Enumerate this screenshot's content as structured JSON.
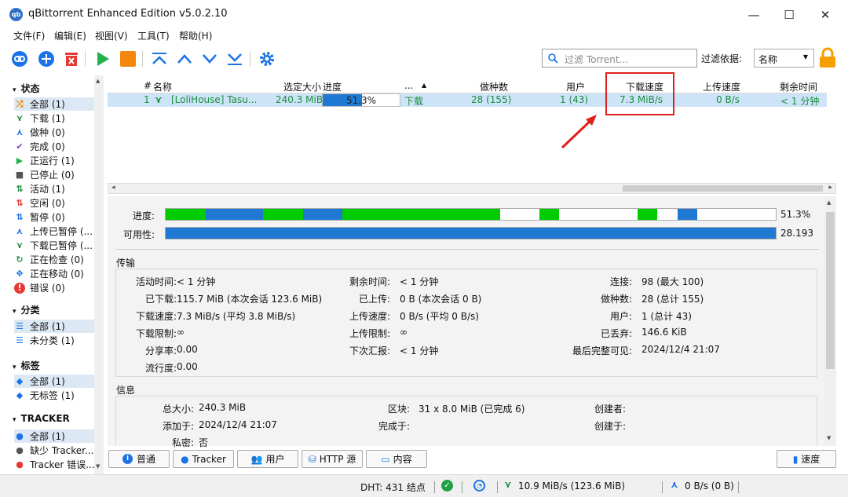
{
  "window": {
    "title": "qBittorrent Enhanced Edition v5.0.2.10",
    "icon_text": "qb",
    "min": "—",
    "max": "☐",
    "close": "✕"
  },
  "menu": [
    "文件(F)",
    "编辑(E)",
    "视图(V)",
    "工具(T)",
    "帮助(H)"
  ],
  "toolbar": {
    "filter_placeholder": "过滤 Torrent...",
    "filter_by_label": "过滤依据:",
    "filter_by_value": "名称"
  },
  "sidebar": {
    "status_header": "状态",
    "status_items": [
      {
        "label": "全部 (1)",
        "icon": "shuffle-icon"
      },
      {
        "label": "下载 (1)",
        "icon": "download-chevrons-icon"
      },
      {
        "label": "做种 (0)",
        "icon": "upload-chevrons-icon"
      },
      {
        "label": "完成 (0)",
        "icon": "check-icon"
      },
      {
        "label": "正运行 (1)",
        "icon": "play-icon"
      },
      {
        "label": "已停止 (0)",
        "icon": "stop-icon"
      },
      {
        "label": "活动 (1)",
        "icon": "active-arrows-icon"
      },
      {
        "label": "空闲 (0)",
        "icon": "idle-arrows-icon"
      },
      {
        "label": "暂停 (0)",
        "icon": "paused-arrows-icon"
      },
      {
        "label": "上传已暂停 (...",
        "icon": "upload-paused-icon"
      },
      {
        "label": "下载已暂停 (...",
        "icon": "download-paused-icon"
      },
      {
        "label": "正在检查 (0)",
        "icon": "checking-icon"
      },
      {
        "label": "正在移动 (0)",
        "icon": "moving-icon"
      },
      {
        "label": "错误 (0)",
        "icon": "error-icon"
      }
    ],
    "category_header": "分类",
    "category_items": [
      {
        "label": "全部 (1)"
      },
      {
        "label": "未分类 (1)"
      }
    ],
    "tags_header": "标签",
    "tags_items": [
      {
        "label": "全部 (1)"
      },
      {
        "label": "无标签 (1)"
      }
    ],
    "tracker_header": "TRACKER",
    "tracker_items": [
      {
        "label": "全部 (1)"
      },
      {
        "label": "缺少 Tracker..."
      },
      {
        "label": "Tracker 错误..."
      }
    ]
  },
  "table": {
    "columns": [
      "#",
      "名称",
      "选定大小",
      "进度",
      "...",
      "做种数",
      "用户",
      "下载速度",
      "上传速度",
      "剩余时间"
    ],
    "rows": [
      {
        "index": "1",
        "name": "[LoliHouse] Tasu...",
        "size": "240.3 MiB",
        "progress_text": "51.3%",
        "progress": 0.513,
        "status": "下载",
        "seeds": "28 (155)",
        "peers": "1 (43)",
        "down_speed": "7.3 MiB/s",
        "up_speed": "0 B/s",
        "eta": "< 1 分钟"
      }
    ]
  },
  "progress_section": {
    "progress_label": "进度:",
    "progress_value": "51.3%",
    "availability_label": "可用性:",
    "availability_value": "28.193"
  },
  "transfer": {
    "header": "传输",
    "fields": [
      {
        "label": "活动时间:",
        "value": "< 1 分钟"
      },
      {
        "label": "已下载:",
        "value": "115.7 MiB (本次会话 123.6 MiB)"
      },
      {
        "label": "下载速度:",
        "value": "7.3 MiB/s (平均 3.8 MiB/s)"
      },
      {
        "label": "下载限制:",
        "value": "∞"
      },
      {
        "label": "分享率:",
        "value": "0.00"
      },
      {
        "label": "流行度:",
        "value": "0.00"
      },
      {
        "label": "剩余时间:",
        "value": "< 1 分钟"
      },
      {
        "label": "已上传:",
        "value": "0 B (本次会话 0 B)"
      },
      {
        "label": "上传速度:",
        "value": "0 B/s (平均 0 B/s)"
      },
      {
        "label": "上传限制:",
        "value": "∞"
      },
      {
        "label": "下次汇报:",
        "value": "< 1 分钟"
      },
      {
        "label": "连接:",
        "value": "98 (最大 100)"
      },
      {
        "label": "做种数:",
        "value": "28 (总计 155)"
      },
      {
        "label": "用户:",
        "value": "1 (总计 43)"
      },
      {
        "label": "已丢弃:",
        "value": "146.6 KiB"
      },
      {
        "label": "最后完整可见:",
        "value": "2024/12/4 21:07"
      }
    ]
  },
  "info": {
    "header": "信息",
    "fields": [
      {
        "label": "总大小:",
        "value": "240.3 MiB"
      },
      {
        "label": "添加于:",
        "value": "2024/12/4 21:07"
      },
      {
        "label": "私密:",
        "value": "否"
      },
      {
        "label": "区块:",
        "value": "31 x 8.0 MiB (已完成 6)"
      },
      {
        "label": "完成于:",
        "value": ""
      },
      {
        "label": "创建者:",
        "value": ""
      },
      {
        "label": "创建于:",
        "value": ""
      }
    ]
  },
  "tabs": [
    "普通",
    "Tracker",
    "用户",
    "HTTP 源",
    "内容"
  ],
  "speed_button": "速度",
  "status": {
    "dht": "DHT: 431 结点",
    "download": "10.9 MiB/s (123.6 MiB)",
    "upload": "0 B/s (0 B)"
  },
  "colors": {
    "accent": "#1a73e8",
    "green_text": "#1a8f3c",
    "highlight_red": "#e0201b",
    "piece_green": "#00cc00",
    "piece_blue": "#1f78d1"
  }
}
